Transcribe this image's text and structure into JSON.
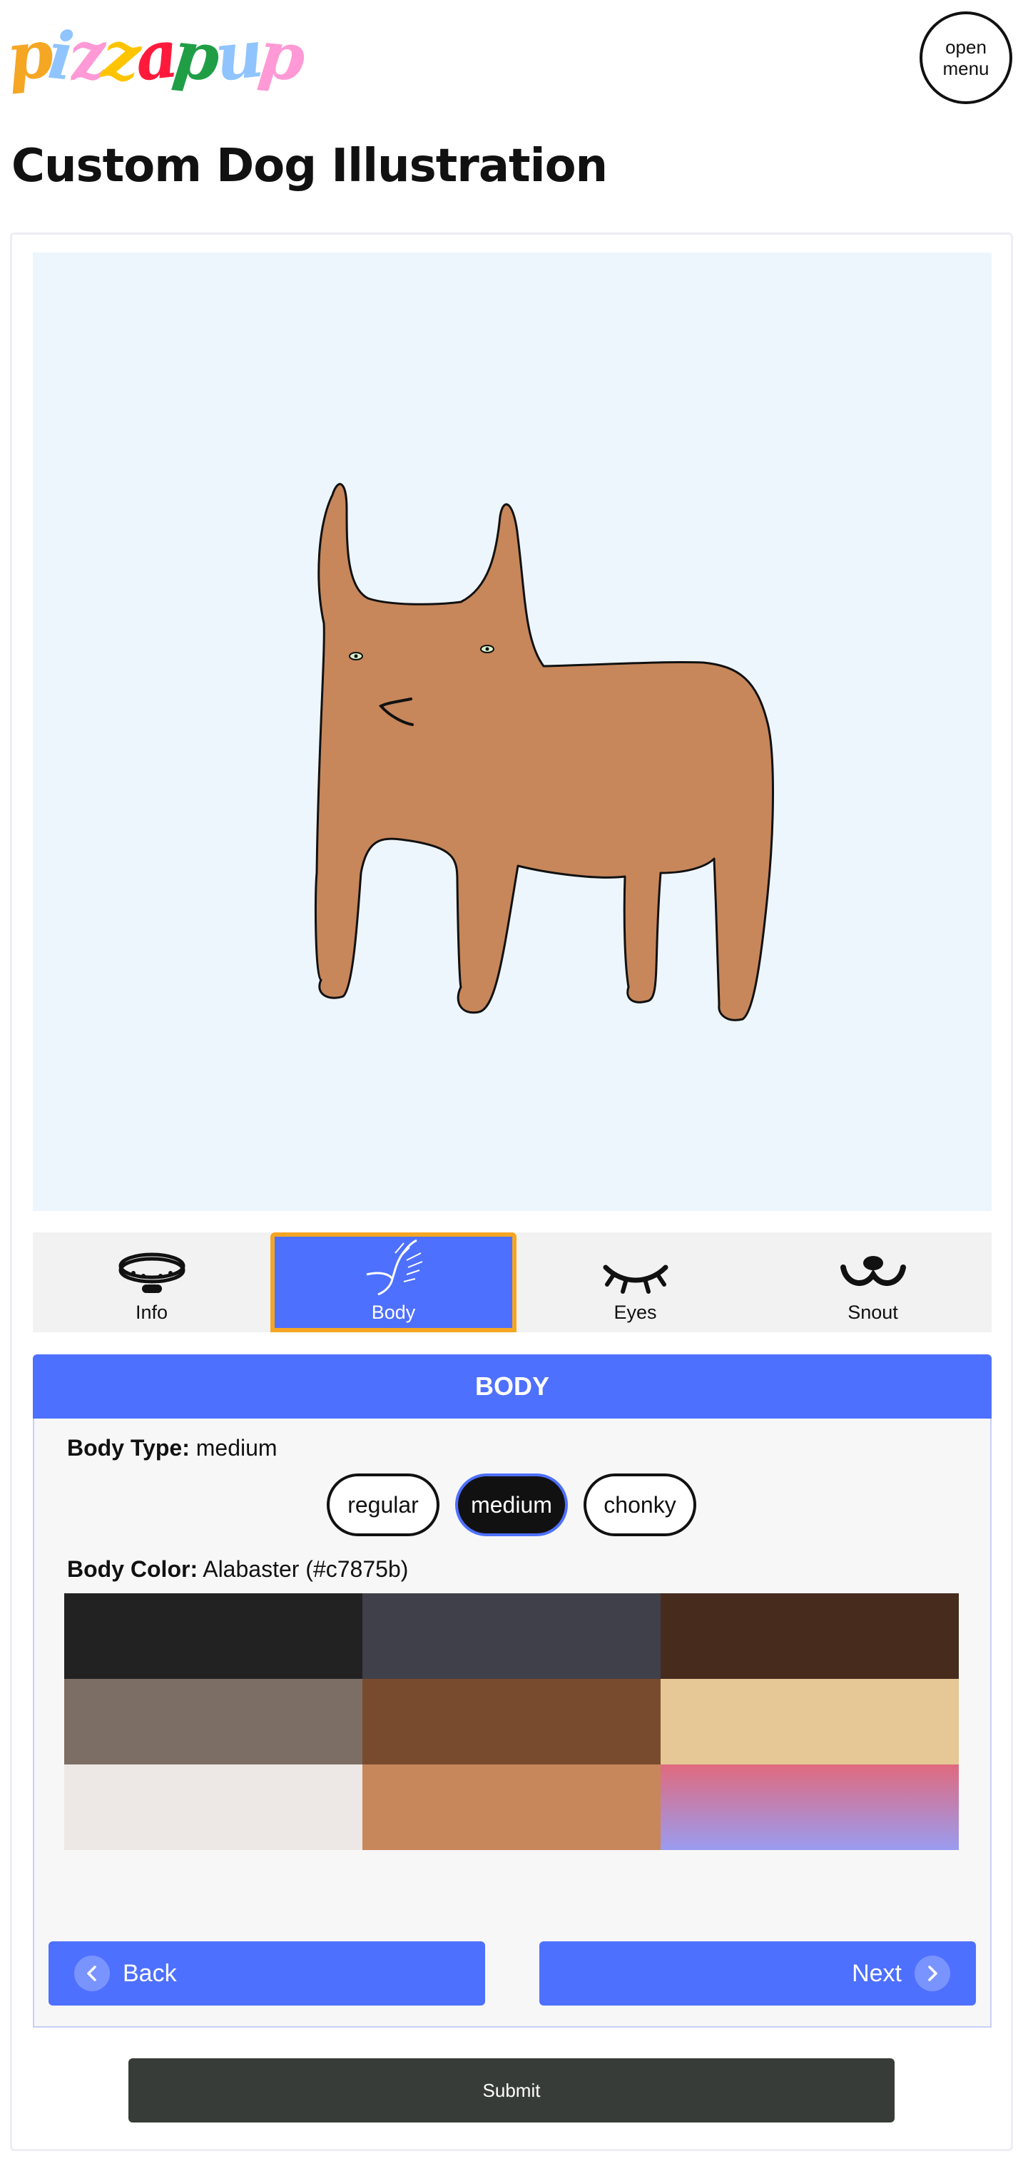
{
  "header": {
    "logo_letters": [
      {
        "char": "p",
        "color": "#f5a623"
      },
      {
        "char": "i",
        "color": "#8fc4ff"
      },
      {
        "char": "z",
        "color": "#ff9ad6"
      },
      {
        "char": "z",
        "color": "#ffc400"
      },
      {
        "char": "a",
        "color": "#ff1a3c"
      },
      {
        "char": "p",
        "color": "#1f9e46"
      },
      {
        "char": "u",
        "color": "#8fc4ff"
      },
      {
        "char": "p",
        "color": "#ff9ad6"
      }
    ],
    "menu_label": "open menu"
  },
  "page": {
    "title": "Custom Dog Illustration"
  },
  "tabs": [
    {
      "label": "Info",
      "icon": "collar-icon",
      "active": false
    },
    {
      "label": "Body",
      "icon": "wagging-tail-icon",
      "active": true
    },
    {
      "label": "Eyes",
      "icon": "closed-eye-icon",
      "active": false
    },
    {
      "label": "Snout",
      "icon": "snout-icon",
      "active": false
    }
  ],
  "panel": {
    "heading": "BODY",
    "body_type_label": "Body Type:",
    "body_type_value": "medium",
    "body_type_options": [
      "regular",
      "medium",
      "chonky"
    ],
    "body_type_selected": "medium",
    "body_color_label": "Body Color:",
    "body_color_value": "Alabaster (#c7875b)",
    "swatch_colors": [
      "#222222",
      "#40404a",
      "#472b1d",
      "#7c6e65",
      "#784b2e",
      "#e5c895",
      "#ede8e5",
      "#c7875b",
      "gradient-pink-purple"
    ]
  },
  "navigation": {
    "back_label": "Back",
    "next_label": "Next"
  },
  "submit_label": "Submit",
  "colors": {
    "accent": "#4e70ff",
    "active_tab_border": "#f5a623",
    "canvas_bg": "#eef6fd",
    "dog_fill": "#c7875b",
    "submit_bg": "#383c38"
  }
}
